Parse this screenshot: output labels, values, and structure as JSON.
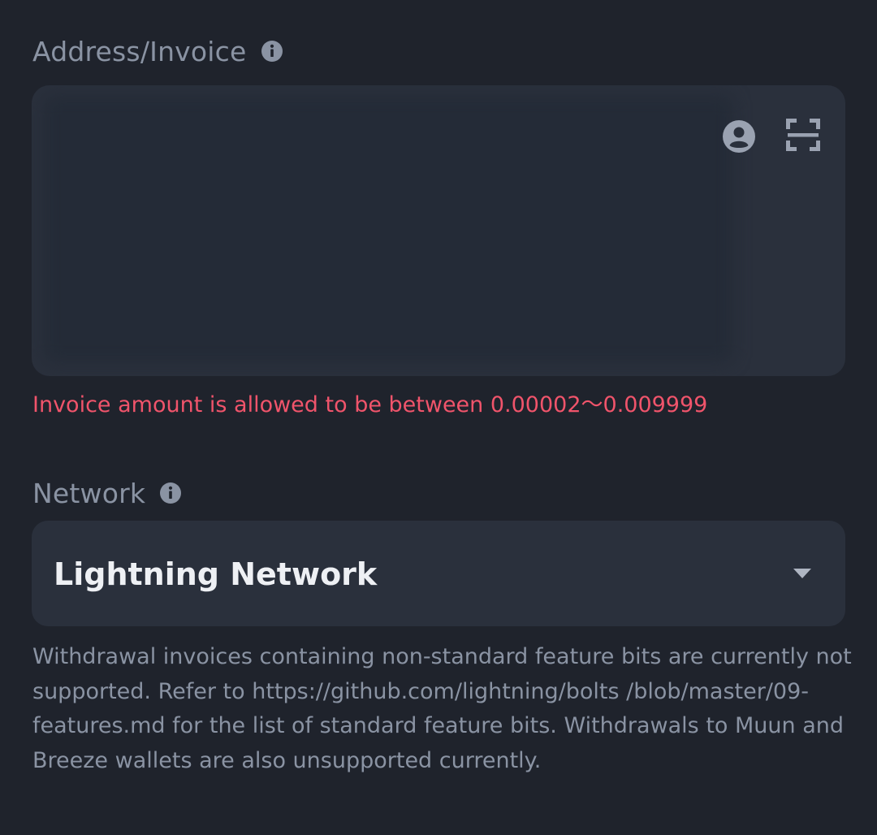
{
  "address": {
    "label": "Address/Invoice",
    "info_icon": "info-icon",
    "value": "",
    "contact_icon": "contact-book-icon",
    "scan_icon": "qr-scan-icon",
    "error": "Invoice amount is allowed to be between 0.00002～0.009999"
  },
  "network": {
    "label": "Network",
    "info_icon": "info-icon",
    "selected": "Lightning Network",
    "chevron_icon": "chevron-down-icon",
    "hint": "Withdrawal invoices containing non-standard feature bits are currently not supported. Refer to https://github.com/lightning/bolts /blob/master/09-features.md for the list of standard feature bits. Withdrawals to Muun and Breeze wallets are also unsupported currently."
  },
  "colors": {
    "background": "#1f232c",
    "field": "#2a303c",
    "label": "#8a93a3",
    "error": "#f0546b",
    "value_text": "#eef0f4"
  }
}
